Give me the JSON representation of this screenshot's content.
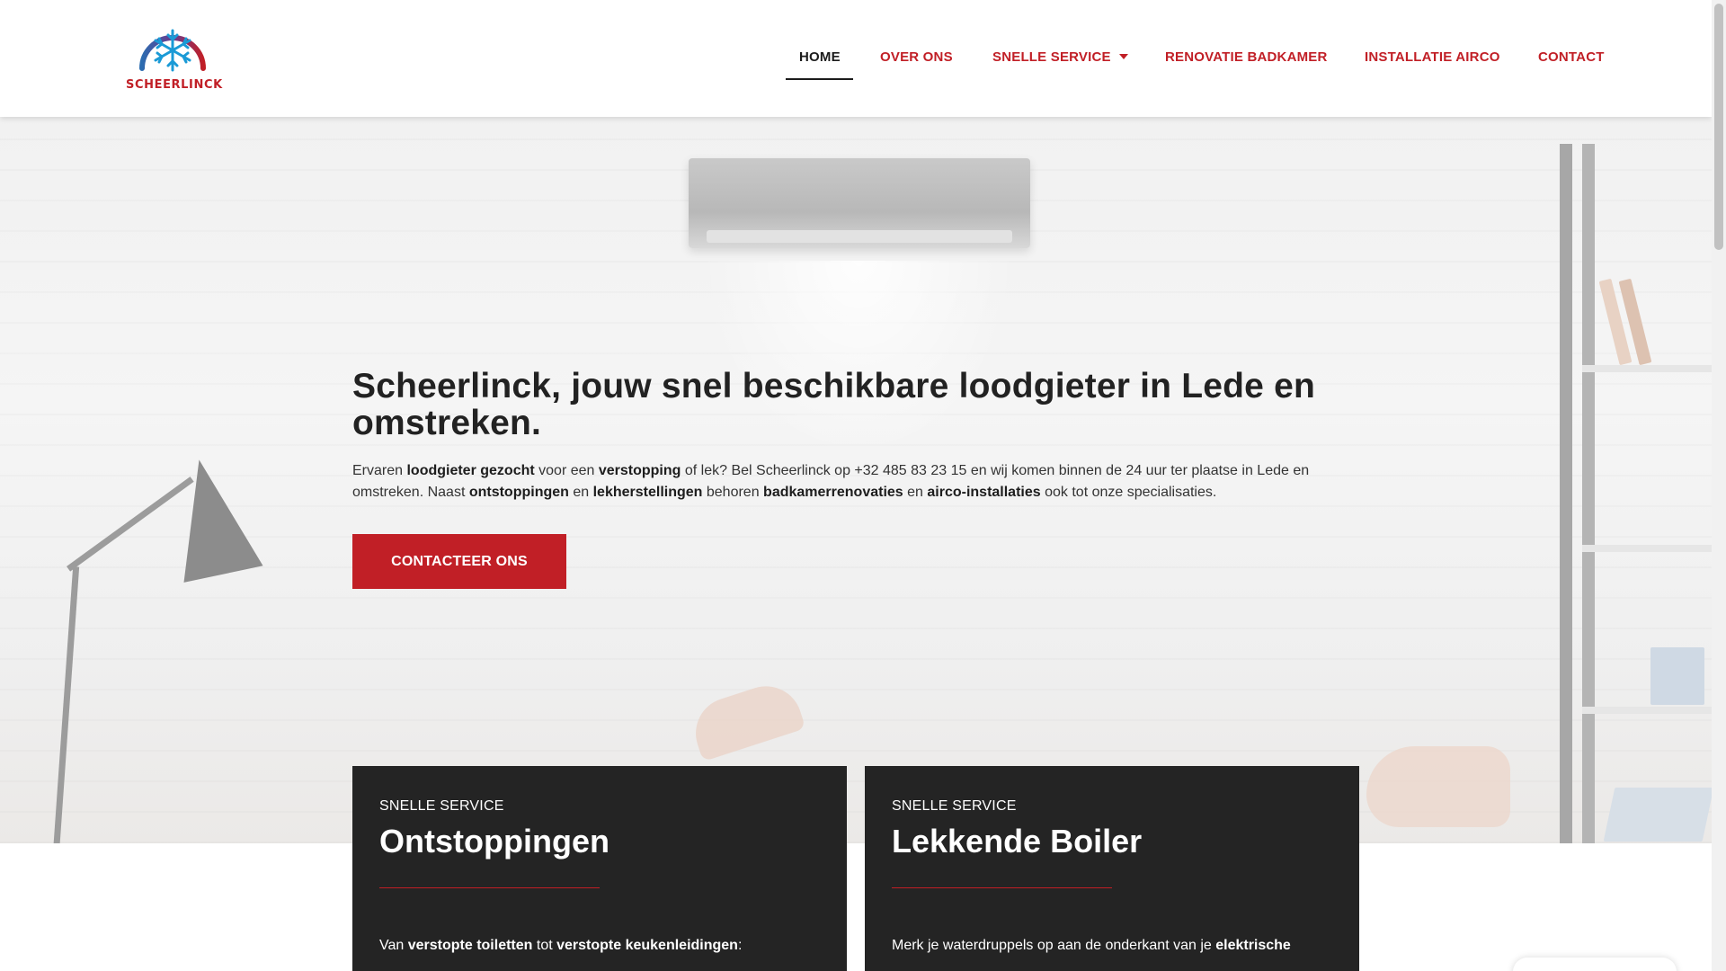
{
  "brand": {
    "name": "SCHEERLINCK",
    "accent_color": "#c11f26",
    "dark_color": "#242424"
  },
  "nav": {
    "items": [
      {
        "label": "HOME",
        "active": true
      },
      {
        "label": "OVER ONS"
      },
      {
        "label": "SNELLE SERVICE",
        "has_dropdown": true
      },
      {
        "label": "RENOVATIE BADKAMER"
      },
      {
        "label": "INSTALLATIE AIRCO"
      },
      {
        "label": "CONTACT"
      }
    ]
  },
  "hero": {
    "title": "Scheerlinck, jouw snel beschikbare loodgieter in Lede en omstreken.",
    "text": {
      "p1": "Ervaren ",
      "b1": "loodgieter gezocht",
      "p2": " voor een ",
      "b2": "verstopping",
      "p3": " of lek? Bel Scheerlinck op +32 485 83 23 15 en wij komen binnen de 24 uur ter plaatse in Lede en omstreken. Naast ",
      "b3": "ontstoppingen",
      "p4": " en ",
      "b4": "lekherstellingen",
      "p5": " behoren ",
      "b5": "badkamerrenovaties",
      "p6": " en ",
      "b6": "airco-installaties",
      "p7": " ook tot onze specialisaties."
    },
    "cta_label": "CONTACTEER ONS"
  },
  "cards": [
    {
      "eyebrow": "SNELLE SERVICE",
      "title": "Ontstoppingen",
      "text": {
        "p1": "Van ",
        "b1": "verstopte toiletten",
        "p2": " tot ",
        "b2": "verstopte keukenleidingen",
        "p3": ":"
      }
    },
    {
      "eyebrow": "SNELLE SERVICE",
      "title": "Lekkende Boiler",
      "text": {
        "p1": "Merk je waterdruppels op aan de onderkant van je ",
        "b1": "elektrische"
      }
    }
  ],
  "icons": {
    "logo": "snowflake-icon",
    "dropdown": "caret-down-icon"
  }
}
